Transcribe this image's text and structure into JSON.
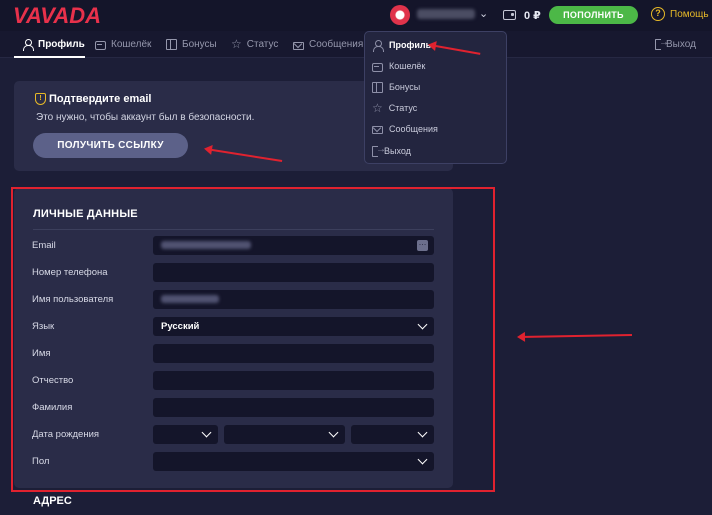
{
  "header": {
    "logo": "VAVADA",
    "balance": "0 ₽",
    "deposit_label": "ПОПОЛНИТЬ",
    "help_label": "Помощь"
  },
  "tabs": [
    {
      "label": "Профиль",
      "icon": "user-icon",
      "active": true
    },
    {
      "label": "Кошелёк",
      "icon": "wallet-icon"
    },
    {
      "label": "Бонусы",
      "icon": "gift-icon"
    },
    {
      "label": "Статус",
      "icon": "star-icon"
    },
    {
      "label": "Сообщения",
      "icon": "mail-icon"
    },
    {
      "label": "Выход",
      "icon": "exit-icon"
    }
  ],
  "dropdown": [
    {
      "label": "Профиль",
      "icon": "user-icon",
      "active": true
    },
    {
      "label": "Кошелёк",
      "icon": "wallet-icon"
    },
    {
      "label": "Бонусы",
      "icon": "gift-icon"
    },
    {
      "label": "Статус",
      "icon": "star-icon"
    },
    {
      "label": "Сообщения",
      "icon": "mail-icon"
    },
    {
      "label": "Выход",
      "icon": "exit-icon"
    }
  ],
  "verify": {
    "title": "Подтвердите email",
    "text": "Это нужно, чтобы аккаунт был в безопасности.",
    "button_label": "ПОЛУЧИТЬ ССЫЛКУ"
  },
  "personal": {
    "title": "ЛИЧНЫЕ ДАННЫЕ",
    "fields": {
      "email": {
        "label": "Email"
      },
      "phone": {
        "label": "Номер телефона"
      },
      "username": {
        "label": "Имя пользователя"
      },
      "language": {
        "label": "Язык",
        "value": "Русский"
      },
      "first_name": {
        "label": "Имя"
      },
      "patronymic": {
        "label": "Отчество"
      },
      "last_name": {
        "label": "Фамилия"
      },
      "birth_date": {
        "label": "Дата рождения"
      },
      "gender": {
        "label": "Пол"
      }
    }
  },
  "address": {
    "title": "АДРЕС"
  },
  "colors": {
    "brand": "#e8314b",
    "deposit": "#4cb847",
    "help": "#e7b928",
    "annotation": "#e0222f",
    "background": "#1c1e37",
    "card": "#2a2c48",
    "input": "#14152a"
  }
}
